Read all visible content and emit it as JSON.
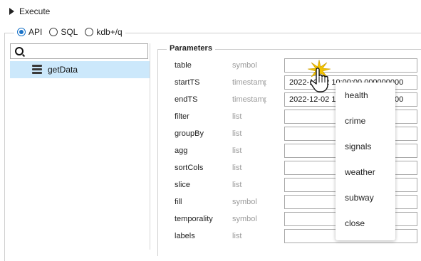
{
  "toolbar": {
    "execute_label": "Execute"
  },
  "modes": [
    {
      "label": "API",
      "selected": true
    },
    {
      "label": "SQL",
      "selected": false
    },
    {
      "label": "kdb+/q",
      "selected": false
    }
  ],
  "search": {
    "value": ""
  },
  "tree": {
    "items": [
      {
        "label": "getData",
        "icon": "database-icon",
        "selected": true
      }
    ]
  },
  "parameters": {
    "title": "Parameters",
    "rows": [
      {
        "name": "table",
        "type": "symbol",
        "value": ""
      },
      {
        "name": "startTS",
        "type": "timestamp",
        "value": "2022-12-02 10:00:00.000000000"
      },
      {
        "name": "endTS",
        "type": "timestamp",
        "value": "2022-12-02 10:30:00.000000000"
      },
      {
        "name": "filter",
        "type": "list",
        "value": ""
      },
      {
        "name": "groupBy",
        "type": "list",
        "value": ""
      },
      {
        "name": "agg",
        "type": "list",
        "value": ""
      },
      {
        "name": "sortCols",
        "type": "list",
        "value": ""
      },
      {
        "name": "slice",
        "type": "list",
        "value": ""
      },
      {
        "name": "fill",
        "type": "symbol",
        "value": ""
      },
      {
        "name": "temporality",
        "type": "symbol",
        "value": ""
      },
      {
        "name": "labels",
        "type": "list",
        "value": ""
      }
    ]
  },
  "table_dropdown": {
    "options": [
      "health",
      "crime",
      "signals",
      "weather",
      "subway",
      "close"
    ]
  },
  "colors": {
    "accent": "#1a73c8",
    "selection": "#cce8fb",
    "click_burst": "#f2c300"
  }
}
